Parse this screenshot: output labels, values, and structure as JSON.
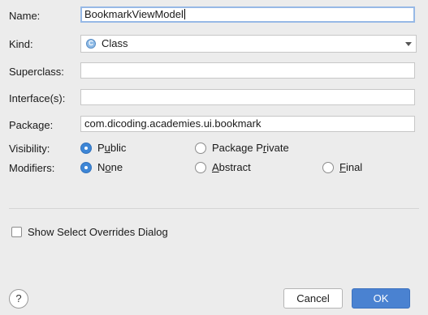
{
  "labels": {
    "name": "Name:",
    "kind": "Kind:",
    "superclass": "Superclass:",
    "interfaces": "Interface(s):",
    "package": "Package:",
    "visibility": "Visibility:",
    "modifiers": "Modifiers:"
  },
  "fields": {
    "name_value": "BookmarkViewModel",
    "kind_value": "Class",
    "kind_icon_letter": "C",
    "superclass_value": "",
    "interfaces_value": "",
    "package_value": "com.dicoding.academies.ui.bookmark"
  },
  "visibility": {
    "options": [
      {
        "pre": "P",
        "u": "u",
        "post": "blic",
        "selected": true
      },
      {
        "pre": "Package P",
        "u": "r",
        "post": "ivate",
        "selected": false
      }
    ]
  },
  "modifiers": {
    "options": [
      {
        "pre": "N",
        "u": "o",
        "post": "ne",
        "selected": true
      },
      {
        "pre": "",
        "u": "A",
        "post": "bstract",
        "selected": false
      },
      {
        "pre": "",
        "u": "F",
        "post": "inal",
        "selected": false
      }
    ]
  },
  "show_overrides": {
    "label": "Show Select Overrides Dialog",
    "checked": false
  },
  "buttons": {
    "help": "?",
    "cancel": "Cancel",
    "ok": "OK"
  },
  "colors": {
    "accent": "#4a82d1",
    "background": "#ececec"
  }
}
